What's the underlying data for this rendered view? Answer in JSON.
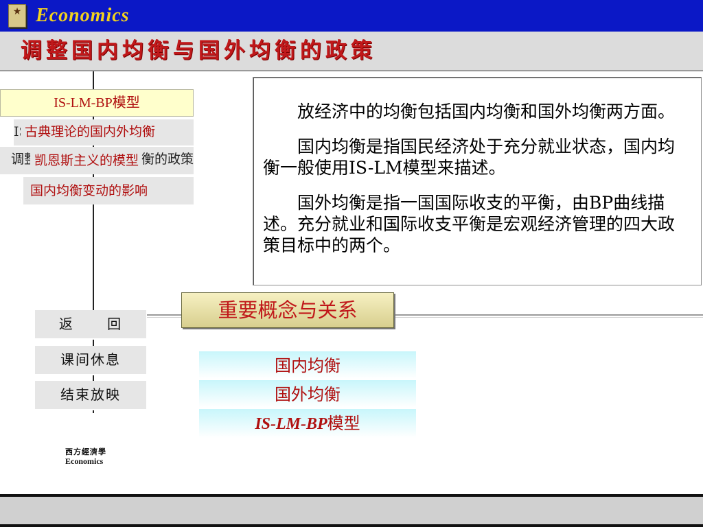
{
  "header": {
    "brand": "Economics",
    "title": "调整国内均衡与国外均衡的政策"
  },
  "left_menu": {
    "items": [
      {
        "label": "IS-LM-BP模型"
      },
      {
        "hidden_label": "IS曲线",
        "label": "古典理论的国内外均衡"
      },
      {
        "hidden_label": "调整国内均衡与国外均衡的政策",
        "label": "凯恩斯主义的模型"
      },
      {
        "label": "国内均衡变动的影响"
      }
    ]
  },
  "info_box": {
    "paragraphs": [
      "放经济中的均衡包括国内均衡和国外均衡两方面。",
      "国内均衡是指国民经济处于充分就业状态，国内均衡一般使用IS-LM模型来描述。",
      "国外均衡是指一国国际收支的平衡，由BP曲线描述。充分就业和国际收支平衡是宏观经济管理的四大政策目标中的两个。"
    ]
  },
  "concept_header": "重要概念与关系",
  "nav": {
    "back": "返  回",
    "break": "课间休息",
    "end": "结束放映"
  },
  "concepts": {
    "item1": "国内均衡",
    "item2": "国外均衡",
    "item3_en": "IS-LM-BP",
    "item3_cn": "模型"
  },
  "footer_logo": {
    "cn": "西方經濟學",
    "en": "Economics"
  },
  "colors": {
    "banner_blue": "#0b18c6",
    "brand_yellow": "#f2d21e",
    "title_red": "#c0181a",
    "menu_red": "#b01010",
    "concept_gold": "#d8cf8e",
    "item_cyan": "#c8f6fb"
  }
}
